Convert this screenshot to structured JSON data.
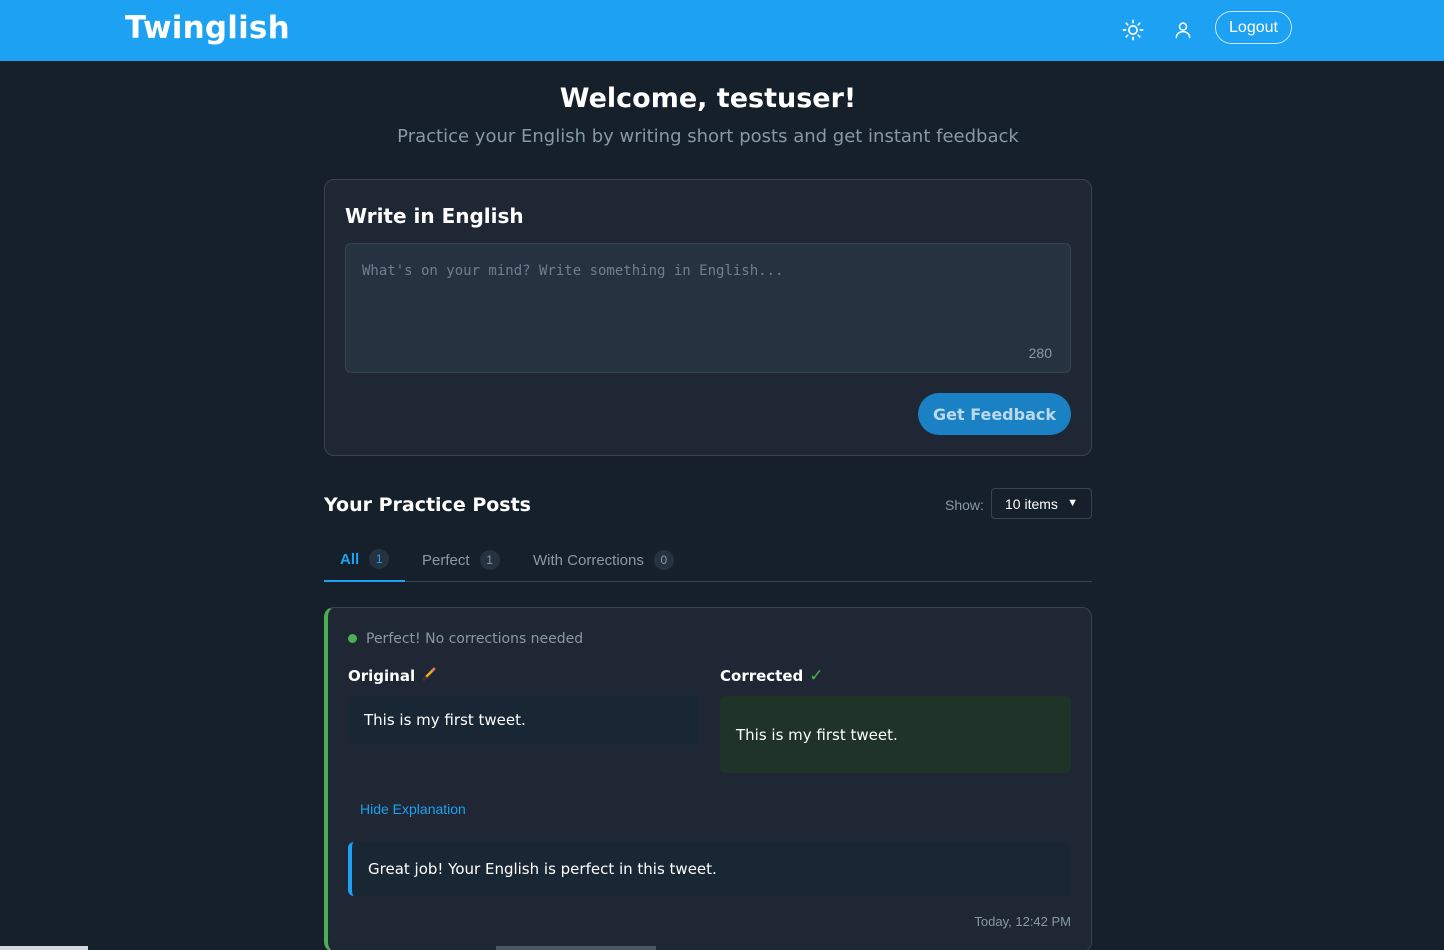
{
  "header": {
    "brand": "Twinglish",
    "theme_toggle_icon": "sun-icon",
    "profile_icon": "user-icon",
    "logout_label": "Logout"
  },
  "welcome": {
    "title": "Welcome, testuser!",
    "subtitle": "Practice your English by writing short posts and get instant feedback"
  },
  "compose": {
    "title": "Write in English",
    "placeholder": "What's on your mind? Write something in English...",
    "value": "",
    "char_count": "280",
    "submit_label": "Get Feedback"
  },
  "posts": {
    "title": "Your Practice Posts",
    "show_label": "Show:",
    "show_value": "10 items",
    "tabs": [
      {
        "label": "All",
        "count": "1",
        "active": true
      },
      {
        "label": "Perfect",
        "count": "1",
        "active": false
      },
      {
        "label": "With Corrections",
        "count": "0",
        "active": false
      }
    ],
    "items": [
      {
        "status": "Perfect! No corrections needed",
        "original_label": "Original",
        "original_glyph": "✏️",
        "original_text": "This is my first tweet.",
        "corrected_label": "Corrected",
        "corrected_glyph": "✓",
        "corrected_text": "This is my first tweet.",
        "toggle_label": "Hide Explanation",
        "explanation": "Great job! Your English is perfect in this tweet.",
        "timestamp": "Today, 12:42 PM"
      }
    ]
  },
  "colors": {
    "header_bg": "#1da1f2",
    "page_bg": "#16202b",
    "card_bg": "#1e2733",
    "accent": "#1da1f2",
    "success": "#4caf50"
  }
}
